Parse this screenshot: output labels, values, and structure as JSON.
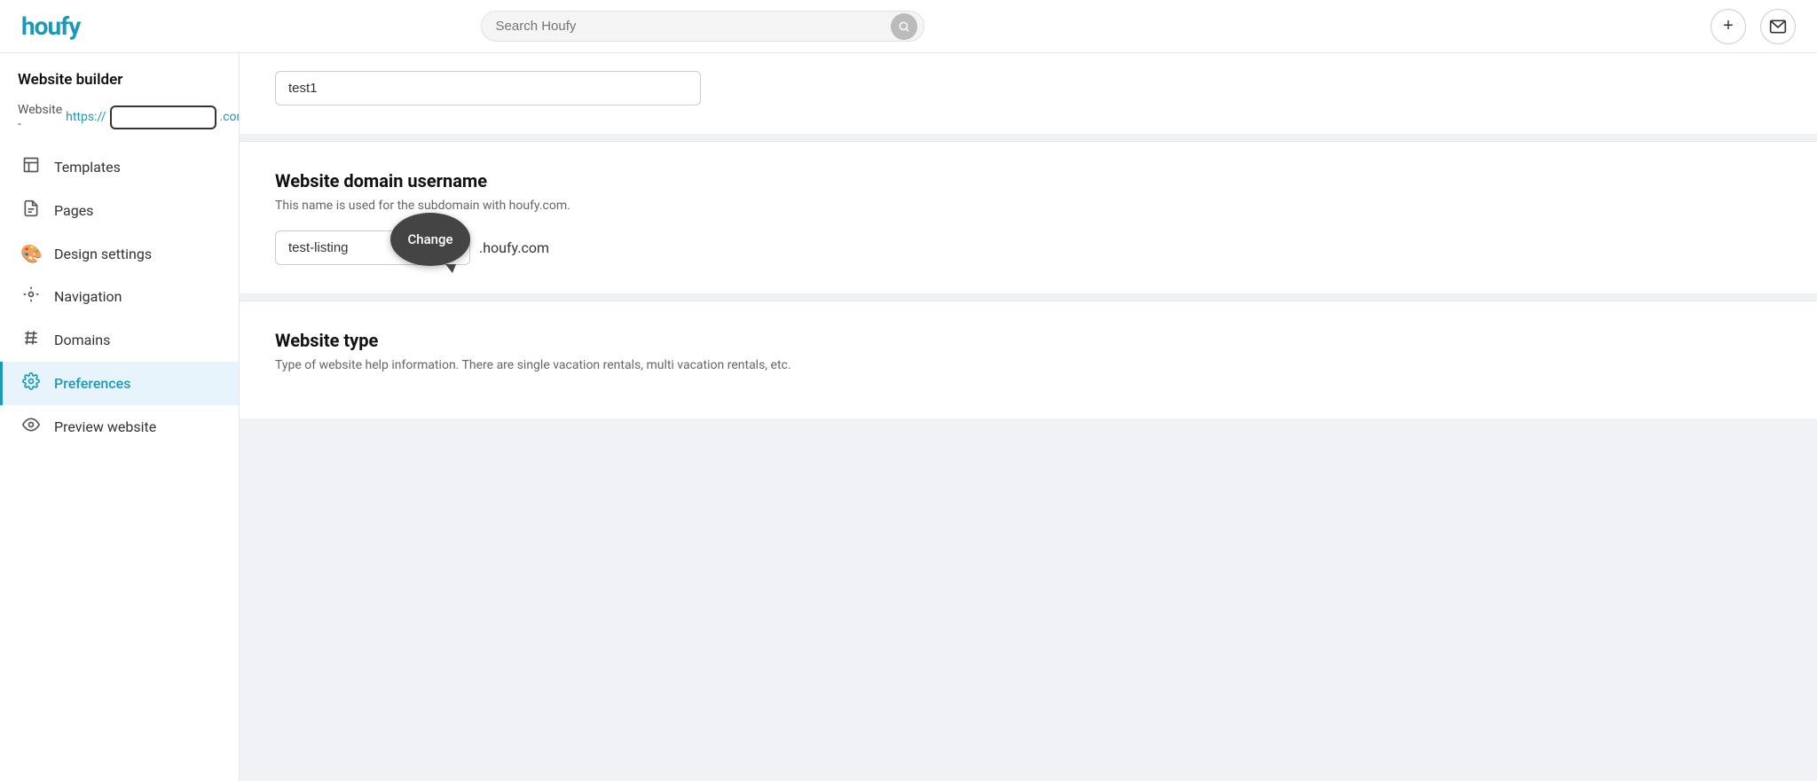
{
  "header": {
    "logo": "houfy",
    "search_placeholder": "Search Houfy",
    "search_value": "",
    "add_btn_label": "+",
    "mail_btn_label": "✉"
  },
  "sidebar": {
    "section_title": "Website builder",
    "website_label": "Website - ",
    "website_link_text": "https://",
    "website_link_suffix": ".com",
    "website_input_value": "",
    "items": [
      {
        "id": "templates",
        "label": "Templates",
        "icon": "☐"
      },
      {
        "id": "pages",
        "label": "Pages",
        "icon": "📄"
      },
      {
        "id": "design",
        "label": "Design settings",
        "icon": "🎨"
      },
      {
        "id": "navigation",
        "label": "Navigation",
        "icon": "📍"
      },
      {
        "id": "domains",
        "label": "Domains",
        "icon": "⚙"
      },
      {
        "id": "preferences",
        "label": "Preferences",
        "icon": "⚙",
        "active": true
      },
      {
        "id": "preview",
        "label": "Preview website",
        "icon": "👁"
      }
    ]
  },
  "content": {
    "partial_input_value": "test1",
    "domain_section": {
      "title": "Website domain username",
      "description": "This name is used for the subdomain with houfy.com.",
      "domain_value": "test-listing",
      "domain_suffix": ".houfy.com",
      "change_label": "Change"
    },
    "type_section": {
      "title": "Website type",
      "description": "Type of website help information. There are single vacation rentals, multi vacation rentals, etc."
    }
  }
}
